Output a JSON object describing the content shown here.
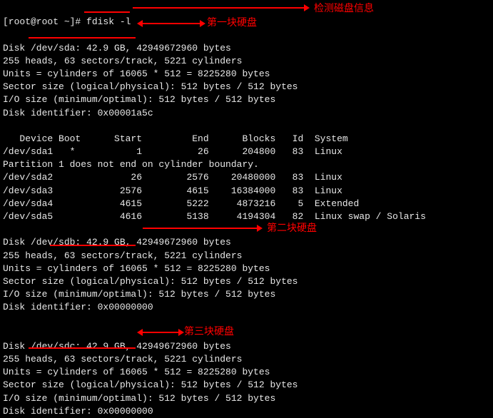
{
  "prompt": "[root@root ~]# ",
  "command": "fdisk -l",
  "annotations": {
    "check_disk_info": "检测磁盘信息",
    "disk1": "第一块硬盘",
    "disk2": "第二块硬盘",
    "disk3": "第三块硬盘"
  },
  "disks": [
    {
      "header": "Disk /dev/sda: 42.9 GB, 42949672960 bytes",
      "geom": "255 heads, 63 sectors/track, 5221 cylinders",
      "units": "Units = cylinders of 16065 * 512 = 8225280 bytes",
      "sector": "Sector size (logical/physical): 512 bytes / 512 bytes",
      "io": "I/O size (minimum/optimal): 512 bytes / 512 bytes",
      "ident": "Disk identifier: 0x00001a5c"
    },
    {
      "header": "Disk /dev/sdb: 42.9 GB, 42949672960 bytes",
      "geom": "255 heads, 63 sectors/track, 5221 cylinders",
      "units": "Units = cylinders of 16065 * 512 = 8225280 bytes",
      "sector": "Sector size (logical/physical): 512 bytes / 512 bytes",
      "io": "I/O size (minimum/optimal): 512 bytes / 512 bytes",
      "ident": "Disk identifier: 0x00000000"
    },
    {
      "header": "Disk /dev/sdc: 42.9 GB, 42949672960 bytes",
      "geom": "255 heads, 63 sectors/track, 5221 cylinders",
      "units": "Units = cylinders of 16065 * 512 = 8225280 bytes",
      "sector": "Sector size (logical/physical): 512 bytes / 512 bytes",
      "io": "I/O size (minimum/optimal): 512 bytes / 512 bytes",
      "ident": "Disk identifier: 0x00000000"
    }
  ],
  "partition_header": "   Device Boot      Start         End      Blocks   Id  System",
  "partitions": [
    "/dev/sda1   *           1          26      204800   83  Linux",
    "Partition 1 does not end on cylinder boundary.",
    "/dev/sda2              26        2576    20480000   83  Linux",
    "/dev/sda3            2576        4615    16384000   83  Linux",
    "/dev/sda4            4615        5222     4873216    5  Extended",
    "/dev/sda5            4616        5138     4194304   82  Linux swap / Solaris"
  ],
  "chart_data": {
    "type": "table",
    "title": "fdisk -l partition table",
    "columns": [
      "Device",
      "Boot",
      "Start",
      "End",
      "Blocks",
      "Id",
      "System"
    ],
    "rows": [
      {
        "Device": "/dev/sda1",
        "Boot": "*",
        "Start": 1,
        "End": 26,
        "Blocks": 204800,
        "Id": "83",
        "System": "Linux"
      },
      {
        "Device": "/dev/sda2",
        "Boot": "",
        "Start": 26,
        "End": 2576,
        "Blocks": 20480000,
        "Id": "83",
        "System": "Linux"
      },
      {
        "Device": "/dev/sda3",
        "Boot": "",
        "Start": 2576,
        "End": 4615,
        "Blocks": 16384000,
        "Id": "83",
        "System": "Linux"
      },
      {
        "Device": "/dev/sda4",
        "Boot": "",
        "Start": 4615,
        "End": 5222,
        "Blocks": 4873216,
        "Id": "5",
        "System": "Extended"
      },
      {
        "Device": "/dev/sda5",
        "Boot": "",
        "Start": 4616,
        "End": 5138,
        "Blocks": 4194304,
        "Id": "82",
        "System": "Linux swap / Solaris"
      }
    ],
    "disks": [
      {
        "device": "/dev/sda",
        "size_gb": 42.9,
        "bytes": 42949672960,
        "identifier": "0x00001a5c"
      },
      {
        "device": "/dev/sdb",
        "size_gb": 42.9,
        "bytes": 42949672960,
        "identifier": "0x00000000"
      },
      {
        "device": "/dev/sdc",
        "size_gb": 42.9,
        "bytes": 42949672960,
        "identifier": "0x00000000"
      }
    ]
  }
}
